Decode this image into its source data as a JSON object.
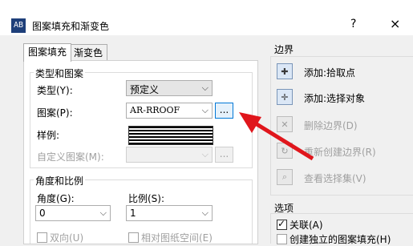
{
  "window": {
    "title": "图案填充和渐变色",
    "help": "?",
    "close": "×",
    "icon": "AB"
  },
  "tabs": [
    {
      "label": "图案填充"
    },
    {
      "label": "渐变色"
    }
  ],
  "type_group": {
    "title": "类型和图案",
    "type_label": "类型(Y):",
    "type_value": "预定义",
    "pattern_label": "图案(P):",
    "pattern_value": "AR-RROOF",
    "browse": "...",
    "sample_label": "样例:",
    "custom_label": "自定义图案(M):",
    "custom_browse": "..."
  },
  "angle_group": {
    "title": "角度和比例",
    "angle_label": "角度(G):",
    "angle_value": "0",
    "scale_label": "比例(S):",
    "scale_value": "1",
    "double_label": "双向(U)",
    "relative_label": "相对图纸空间(E)"
  },
  "boundary": {
    "title": "边界",
    "items": [
      {
        "label": "添加:拾取点",
        "icon": "pick-points-icon"
      },
      {
        "label": "添加:选择对象",
        "icon": "select-objects-icon"
      },
      {
        "label": "删除边界(D)",
        "icon": "remove-boundaries-icon"
      },
      {
        "label": "重新创建边界(R)",
        "icon": "recreate-boundary-icon"
      },
      {
        "label": "查看选择集(V)",
        "icon": "view-selections-icon"
      }
    ]
  },
  "options": {
    "title": "选项",
    "associative_label": "关联(A)",
    "independent_label": "创建独立的图案填充(H)"
  },
  "colors": {
    "arrow": "#e0161c",
    "accent": "#0078d7"
  }
}
